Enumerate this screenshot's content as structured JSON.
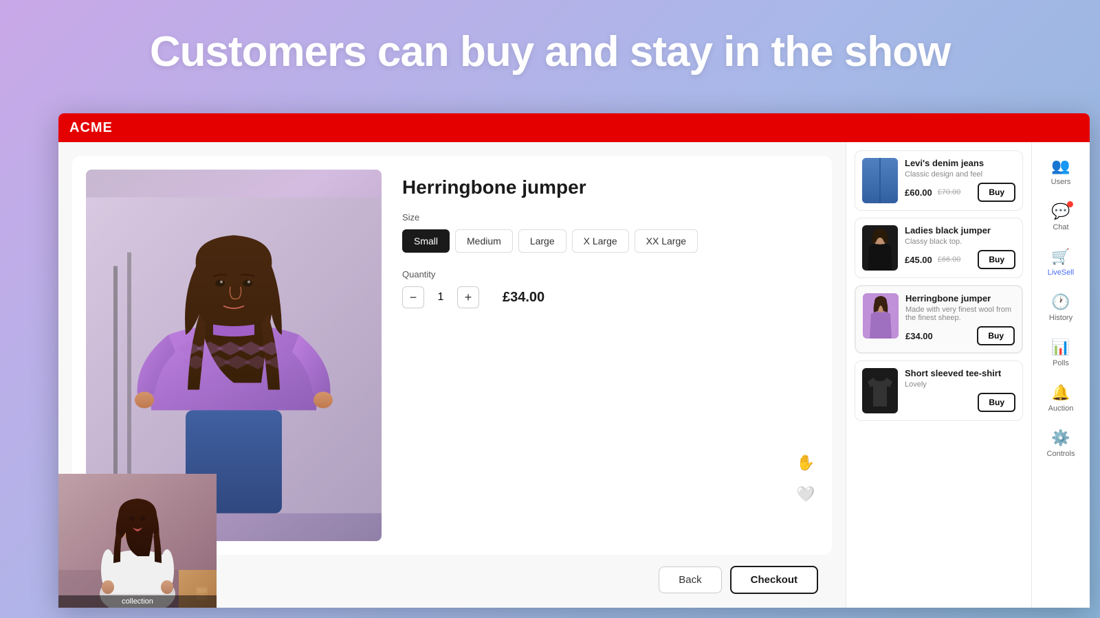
{
  "hero": {
    "title": "Customers can buy and stay in the show"
  },
  "browser": {
    "brand": "ACME"
  },
  "product": {
    "title": "Herringbone jumper",
    "size_label": "Size",
    "sizes": [
      "Small",
      "Medium",
      "Large",
      "X Large",
      "XX Large"
    ],
    "active_size": "Small",
    "quantity_label": "Quantity",
    "quantity": "1",
    "price": "£34.00",
    "back_btn": "Back",
    "checkout_btn": "Checkout"
  },
  "product_list": [
    {
      "name": "Levi's denim jeans",
      "desc": "Classic design and feel",
      "price": "£60.00",
      "old_price": "£70.00",
      "buy_label": "Buy",
      "thumb_type": "jeans"
    },
    {
      "name": "Ladies black jumper",
      "desc": "Classy black top.",
      "price": "£45.00",
      "old_price": "£66.00",
      "buy_label": "Buy",
      "thumb_type": "black-jumper"
    },
    {
      "name": "Herringbone jumper",
      "desc": "Made with very finest wool from the finest sheep.",
      "price": "£34.00",
      "old_price": "",
      "buy_label": "Buy",
      "thumb_type": "herring"
    },
    {
      "name": "Short sleeved tee-shirt",
      "desc": "Lovely",
      "price": "",
      "old_price": "",
      "buy_label": "Buy",
      "thumb_type": "tee"
    }
  ],
  "sidebar": {
    "items": [
      {
        "label": "Users",
        "icon": "👥",
        "active": false
      },
      {
        "label": "Chat",
        "icon": "💬",
        "active": false,
        "badge": true
      },
      {
        "label": "LiveSell",
        "icon": "🛒",
        "active": true
      },
      {
        "label": "History",
        "icon": "🕐",
        "active": false
      },
      {
        "label": "Polls",
        "icon": "📊",
        "active": false
      },
      {
        "label": "Auction",
        "icon": "🔔",
        "active": false
      },
      {
        "label": "Controls",
        "icon": "⚙️",
        "active": false
      }
    ]
  },
  "video": {
    "collection_label": "collection"
  }
}
